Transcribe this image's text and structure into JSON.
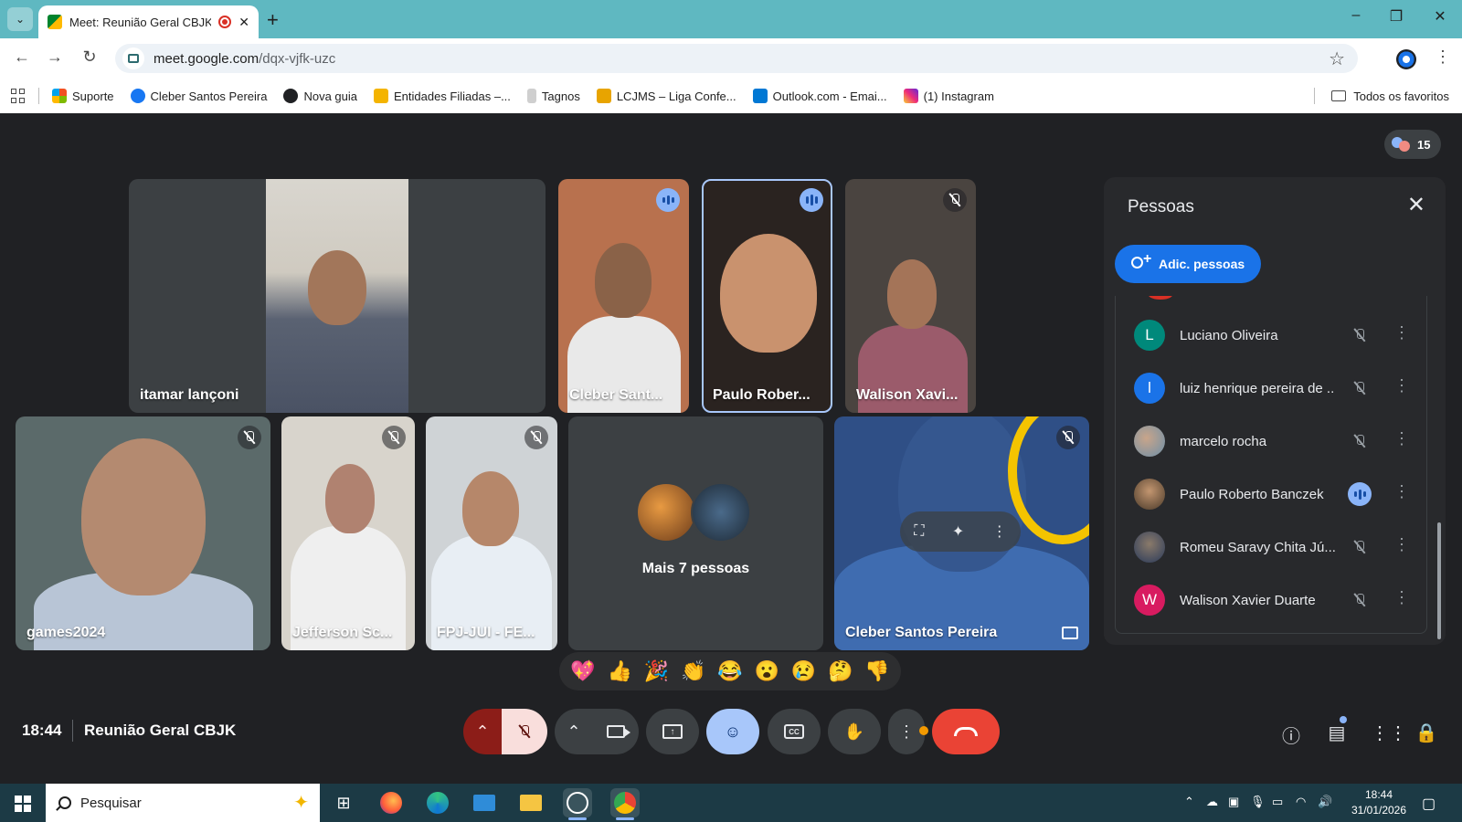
{
  "browser": {
    "tab_title": "Meet: Reunião Geral CBJK",
    "url_domain": "meet.google.com",
    "url_path": "/dqx-vjfk-uzc",
    "bookmarks": [
      {
        "label": "Suporte",
        "color": "#4285f4"
      },
      {
        "label": "Cleber Santos Pereira",
        "color": "#1877f2"
      },
      {
        "label": "Nova guia",
        "color": "#202124"
      },
      {
        "label": "Entidades Filiadas –...",
        "color": "#f4b400"
      },
      {
        "label": "Tagnos",
        "color": "#9e9e9e"
      },
      {
        "label": "LCJMS – Liga Confe...",
        "color": "#f4b400"
      },
      {
        "label": "Outlook.com - Emai...",
        "color": "#0078d4"
      },
      {
        "label": "(1) Instagram",
        "color": "#e1306c"
      }
    ],
    "all_bookmarks_label": "Todos os favoritos"
  },
  "meet": {
    "participant_count": "15",
    "tiles": [
      {
        "name": "itamar lançoni",
        "status": "muted-hidden"
      },
      {
        "name": "Cleber Sant...",
        "status": "speaking"
      },
      {
        "name": "Paulo Rober...",
        "status": "speaking"
      },
      {
        "name": "Walison Xavi...",
        "status": "muted"
      },
      {
        "name": "games2024",
        "status": "muted"
      },
      {
        "name": "Jefferson Sc...",
        "status": "muted"
      },
      {
        "name": "FPJ-JUI - FE...",
        "status": "muted"
      },
      {
        "name": "Cleber Santos Pereira",
        "status": "muted"
      }
    ],
    "more_people_label": "Mais 7 pessoas",
    "meeting_time": "18:44",
    "meeting_name": "Reunião Geral CBJK",
    "reactions": [
      "💖",
      "👍",
      "🎉",
      "👏",
      "😂",
      "😮",
      "😢",
      "🤔",
      "👎"
    ]
  },
  "people_panel": {
    "title": "Pessoas",
    "add_button": "Adic. pessoas",
    "participants": [
      {
        "name": "Luciano Oliveira",
        "initial": "L",
        "color": "#00897b",
        "state": "muted"
      },
      {
        "name": "luiz henrique pereira de ...",
        "initial": "l",
        "color": "#1a73e8",
        "state": "muted"
      },
      {
        "name": "marcelo rocha",
        "initial": "",
        "color": "#6d8fa8",
        "state": "muted"
      },
      {
        "name": "Paulo Roberto Banczek",
        "initial": "",
        "color": "#7a5a3a",
        "state": "speaking"
      },
      {
        "name": "Romeu Saravy Chita Jú...",
        "initial": "",
        "color": "#3a4f6a",
        "state": "muted"
      },
      {
        "name": "Walison Xavier Duarte",
        "initial": "W",
        "color": "#d81b60",
        "state": "muted"
      }
    ]
  },
  "taskbar": {
    "search_placeholder": "Pesquisar",
    "time": "18:44",
    "date": "31/01/2026"
  }
}
